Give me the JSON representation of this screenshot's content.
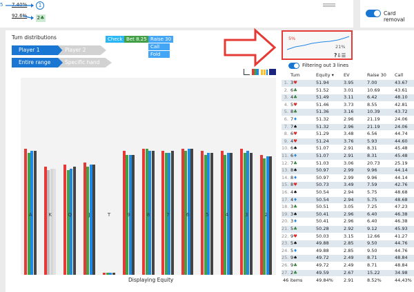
{
  "top": {
    "pct1": "7.40%",
    "pct2": "92.6%",
    "node1": "1",
    "node2_rank": "2",
    "node2_suit": "♣",
    "left_snippet": "5",
    "card_removal": "Card removal"
  },
  "panel": {
    "title": "Turn distributions",
    "actions": {
      "check": "Check",
      "bet": "Bet 8.25",
      "raise": "Raise 30",
      "call": "Call",
      "fold": "Fold"
    },
    "tabs": {
      "player1": "Player 1",
      "player2": "Player 2",
      "entire_range": "Entire range",
      "specific_hand": "Specific hand"
    },
    "thumbnail": {
      "pct_top": "5%",
      "pct_right": "21%",
      "icons": "?⇩☰"
    },
    "filter_text": "Filtering out 3 lines",
    "footer": "Displaying Equity"
  },
  "chart_data": {
    "type": "bar",
    "categories": [
      "A",
      "K",
      "Q",
      "J",
      "T",
      "9",
      "8",
      "7",
      "6",
      "5",
      "4",
      "3",
      "2"
    ],
    "series": [
      {
        "color": "#e53935",
        "values": [
          0.64,
          0.55,
          0.56,
          0.57,
          0.01,
          0.63,
          0.64,
          0.63,
          0.64,
          0.63,
          0.63,
          0.64,
          0.61
        ]
      },
      {
        "color": "#43a047",
        "values": [
          0.62,
          0.53,
          0.53,
          0.55,
          0.01,
          0.61,
          0.64,
          0.62,
          0.63,
          0.61,
          0.61,
          0.62,
          0.59
        ]
      },
      {
        "color": "#1e88e5",
        "values": [
          0.63,
          0.54,
          0.54,
          0.56,
          0.01,
          0.61,
          0.63,
          0.62,
          0.64,
          0.62,
          0.62,
          0.63,
          0.6
        ]
      },
      {
        "color": "#444444",
        "values": [
          0.63,
          0.54,
          0.55,
          0.56,
          0.01,
          0.61,
          0.63,
          0.63,
          0.64,
          0.62,
          0.62,
          0.62,
          0.6
        ]
      }
    ],
    "highlighted_category": "K",
    "ylim": [
      0,
      1
    ]
  },
  "table": {
    "headers": {
      "turn": "Turn",
      "equity": "Equity ▾",
      "ev": "EV",
      "raise": "Raise 30",
      "call": "Call"
    },
    "rows": [
      {
        "n": "1.",
        "r": "3",
        "s": "h",
        "eq": "51.94",
        "ev": "3.95",
        "ra": "7.00",
        "ca": "43.67"
      },
      {
        "n": "2.",
        "r": "6",
        "s": "c",
        "eq": "51.52",
        "ev": "3.01",
        "ra": "10.69",
        "ca": "43.61"
      },
      {
        "n": "3.",
        "r": "4",
        "s": "c",
        "eq": "51.49",
        "ev": "3.11",
        "ra": "6.42",
        "ca": "48.10"
      },
      {
        "n": "4.",
        "r": "5",
        "s": "h",
        "eq": "51.46",
        "ev": "3.73",
        "ra": "8.55",
        "ca": "42.81"
      },
      {
        "n": "5.",
        "r": "8",
        "s": "c",
        "eq": "51.36",
        "ev": "3.16",
        "ra": "10.39",
        "ca": "43.72"
      },
      {
        "n": "6.",
        "r": "7",
        "s": "d",
        "eq": "51.32",
        "ev": "2.96",
        "ra": "21.19",
        "ca": "24.06"
      },
      {
        "n": "7.",
        "r": "7",
        "s": "s",
        "eq": "51.32",
        "ev": "2.96",
        "ra": "21.19",
        "ca": "24.06"
      },
      {
        "n": "8.",
        "r": "6",
        "s": "h",
        "eq": "51.29",
        "ev": "3.48",
        "ra": "6.56",
        "ca": "44.74"
      },
      {
        "n": "9.",
        "r": "4",
        "s": "h",
        "eq": "51.24",
        "ev": "3.76",
        "ra": "5.93",
        "ca": "44.60"
      },
      {
        "n": "10.",
        "r": "6",
        "s": "s",
        "eq": "51.07",
        "ev": "2.91",
        "ra": "8.31",
        "ca": "45.48"
      },
      {
        "n": "11.",
        "r": "6",
        "s": "d",
        "eq": "51.07",
        "ev": "2.91",
        "ra": "8.31",
        "ca": "45.48"
      },
      {
        "n": "12.",
        "r": "7",
        "s": "c",
        "eq": "51.03",
        "ev": "3.06",
        "ra": "20.73",
        "ca": "25.19"
      },
      {
        "n": "13.",
        "r": "8",
        "s": "s",
        "eq": "50.97",
        "ev": "2.99",
        "ra": "9.96",
        "ca": "44.14"
      },
      {
        "n": "14.",
        "r": "8",
        "s": "d",
        "eq": "50.97",
        "ev": "2.99",
        "ra": "9.96",
        "ca": "44.14"
      },
      {
        "n": "15.",
        "r": "8",
        "s": "h",
        "eq": "50.73",
        "ev": "3.49",
        "ra": "7.59",
        "ca": "42.76"
      },
      {
        "n": "16.",
        "r": "4",
        "s": "s",
        "eq": "50.54",
        "ev": "2.94",
        "ra": "5.75",
        "ca": "48.68"
      },
      {
        "n": "17.",
        "r": "4",
        "s": "d",
        "eq": "50.54",
        "ev": "2.94",
        "ra": "5.75",
        "ca": "48.68"
      },
      {
        "n": "18.",
        "r": "3",
        "s": "c",
        "eq": "50.51",
        "ev": "3.05",
        "ra": "7.25",
        "ca": "47.23"
      },
      {
        "n": "19.",
        "r": "3",
        "s": "s",
        "eq": "50.41",
        "ev": "2.96",
        "ra": "6.40",
        "ca": "46.38"
      },
      {
        "n": "20.",
        "r": "3",
        "s": "d",
        "eq": "50.41",
        "ev": "2.96",
        "ra": "6.40",
        "ca": "46.38"
      },
      {
        "n": "21.",
        "r": "5",
        "s": "c",
        "eq": "50.28",
        "ev": "2.92",
        "ra": "9.12",
        "ca": "45.93"
      },
      {
        "n": "22.",
        "r": "9",
        "s": "h",
        "eq": "50.03",
        "ev": "3.15",
        "ra": "12.66",
        "ca": "41.27"
      },
      {
        "n": "23.",
        "r": "5",
        "s": "s",
        "eq": "49.88",
        "ev": "2.85",
        "ra": "9.50",
        "ca": "44.76"
      },
      {
        "n": "24.",
        "r": "5",
        "s": "d",
        "eq": "49.88",
        "ev": "2.85",
        "ra": "9.50",
        "ca": "44.76"
      },
      {
        "n": "25.",
        "r": "9",
        "s": "s",
        "eq": "49.72",
        "ev": "2.49",
        "ra": "8.71",
        "ca": "48.84"
      },
      {
        "n": "26.",
        "r": "9",
        "s": "c",
        "eq": "49.72",
        "ev": "2.49",
        "ra": "8.71",
        "ca": "48.84"
      },
      {
        "n": "27.",
        "r": "2",
        "s": "c",
        "eq": "49.59",
        "ev": "2.67",
        "ra": "15.22",
        "ca": "34.98"
      }
    ],
    "footer": {
      "items": "46 items",
      "eq": "49.84%",
      "ev": "2.91",
      "ra": "8.52%",
      "ca": "44,43%"
    }
  },
  "colors": {
    "accent": "#1976d2",
    "check": "#29b6f6",
    "bet": "#43a047",
    "raise": "#42a5f5",
    "arrow": "#e53935"
  }
}
